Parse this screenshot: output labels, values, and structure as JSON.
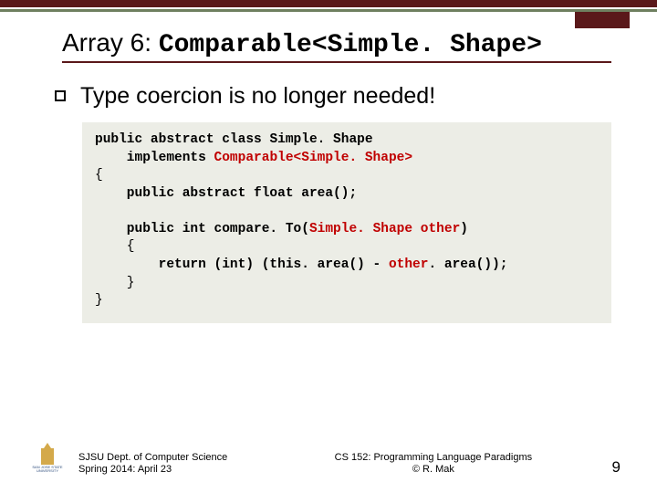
{
  "title": {
    "prefix": "Array 6: ",
    "mono": "Comparable<Simple. Shape>"
  },
  "bullet": "Type coercion is no longer needed!",
  "code": {
    "l1a": "public abstract class ",
    "l1b": "Simple. Shape",
    "l2a": "    implements ",
    "l2b": "Comparable<Simple. Shape>",
    "l3": "{",
    "l4": "    public abstract float area();",
    "l5": "",
    "l6a": "    public int compare. To(",
    "l6b": "Simple. Shape other",
    "l6c": ")",
    "l7": "    {",
    "l8a": "        return (int) (this. area() - ",
    "l8b": "other",
    "l8c": ". area());",
    "l9": "    }",
    "l10": "}"
  },
  "footer": {
    "dept": "SJSU Dept. of Computer Science",
    "term": "Spring 2014: April 23",
    "course": "CS 152: Programming Language Paradigms",
    "copyright": "© R. Mak",
    "page": "9",
    "logo_text": "SAN JOSE STATE UNIVERSITY"
  }
}
